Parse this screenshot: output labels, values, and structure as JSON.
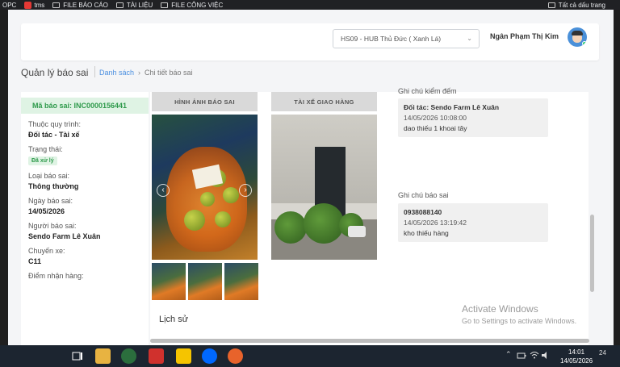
{
  "bookmarks": {
    "items": [
      "OPC",
      "tms",
      "FILE BÁO CÁO",
      "TÀI LIỆU",
      "FILE CÔNG VIỆC"
    ],
    "all_bookmarks": "Tất cả dấu trang"
  },
  "header": {
    "hub_select": "HS09 - HUB Thủ Đức ( Xanh Lá)",
    "user_name": "Ngân Phạm Thị Kim"
  },
  "page": {
    "title": "Quản lý báo sai",
    "breadcrumb_link": "Danh sách",
    "breadcrumb_current": "Chi tiết báo sai"
  },
  "detail": {
    "code": "Mã báo sai: INC0000156441",
    "fields": [
      {
        "label": "Thuộc quy trình:",
        "value": "Đối tác - Tài xế"
      },
      {
        "label": "Trạng thái:",
        "badge": "Đã xử lý"
      },
      {
        "label": "Loại báo sai:",
        "value": "Thông thường"
      },
      {
        "label": "Ngày báo sai:",
        "value": "14/05/2026"
      },
      {
        "label": "Người báo sai:",
        "value": "Sendo Farm Lê Xuân"
      },
      {
        "label": "Chuyến xe:",
        "value": "C11"
      },
      {
        "label": "Điểm nhận hàng:",
        "value": ""
      }
    ]
  },
  "images": {
    "report_header": "HÌNH ẢNH BÁO SAI",
    "driver_header": "TÀI XẾ GIAO HÀNG"
  },
  "notes": {
    "check_label": "Ghi chú kiểm đếm",
    "check_partner": "Đối tác: Sendo Farm Lê Xuân",
    "check_time": "14/05/2026 10:08:00",
    "check_text": "dao thiếu 1 khoai tây",
    "report_label": "Ghi chú báo sai",
    "report_phone": "0938088140",
    "report_time": "14/05/2026 13:19:42",
    "report_text": "kho thiếu hàng"
  },
  "history": {
    "title": "Lịch sử"
  },
  "watermark": {
    "line1": "Activate Windows",
    "line2": "Go to Settings to activate Windows."
  },
  "taskbar": {
    "time": "14:01",
    "date": "14/05/2026",
    "notification_count": "24"
  }
}
